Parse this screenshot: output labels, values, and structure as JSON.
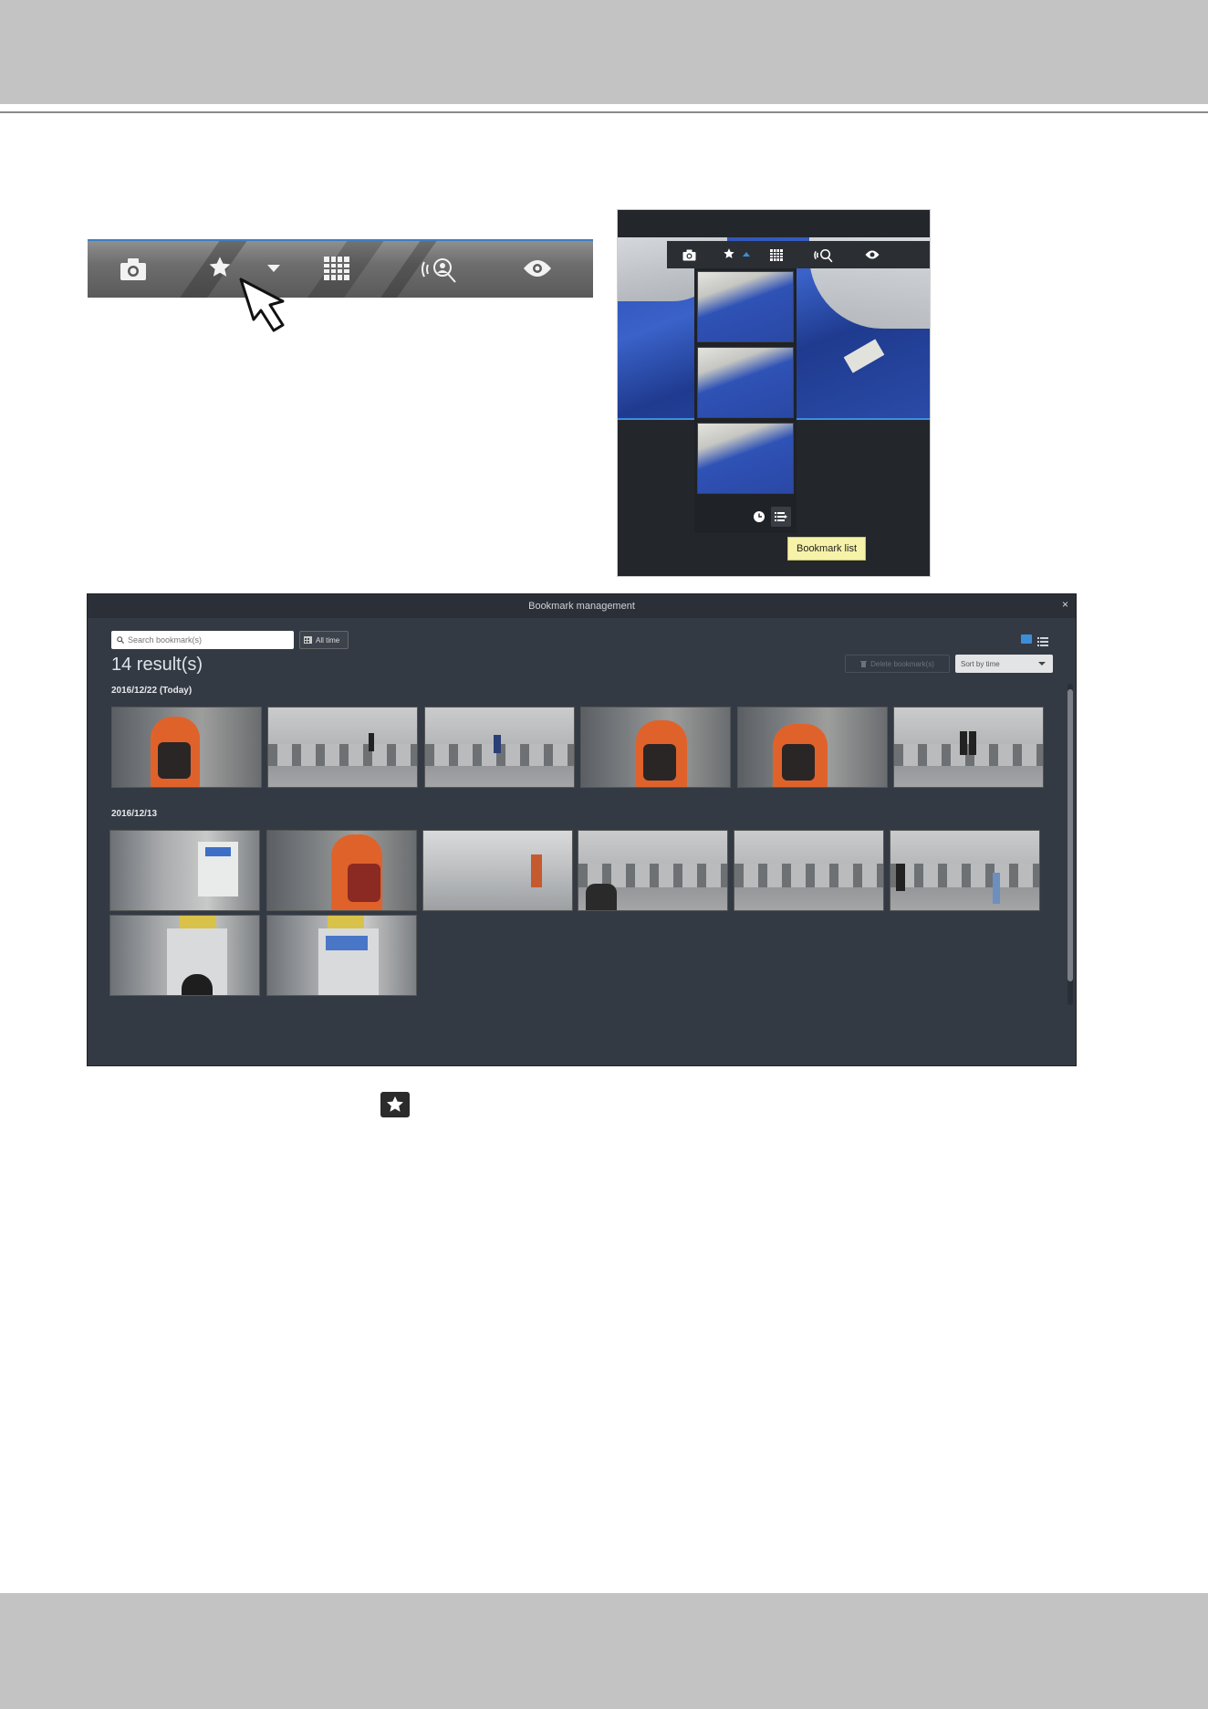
{
  "popover": {
    "tooltip": "Bookmark list"
  },
  "bookmark_management": {
    "title": "Bookmark management",
    "close": "×",
    "search_placeholder": "Search bookmark(s)",
    "all_time_label": "All time",
    "results_count": "14 result(s)",
    "delete_label": "Delete bookmark(s)",
    "sort_label": "Sort by time",
    "groups": [
      {
        "date": "2016/12/22 (Today)",
        "count": 6
      },
      {
        "date": "2016/12/13",
        "count": 8
      }
    ]
  },
  "icons": {
    "toolbar": [
      "camera-icon",
      "star-icon",
      "dropdown-caret-icon",
      "layout-grid-icon",
      "audio-search-icon",
      "eye-icon"
    ],
    "inline": "star-icon"
  },
  "colors": {
    "accent": "#3d8ed8",
    "window_bg": "#343a43",
    "tooltip_bg": "#f6f2a8"
  }
}
